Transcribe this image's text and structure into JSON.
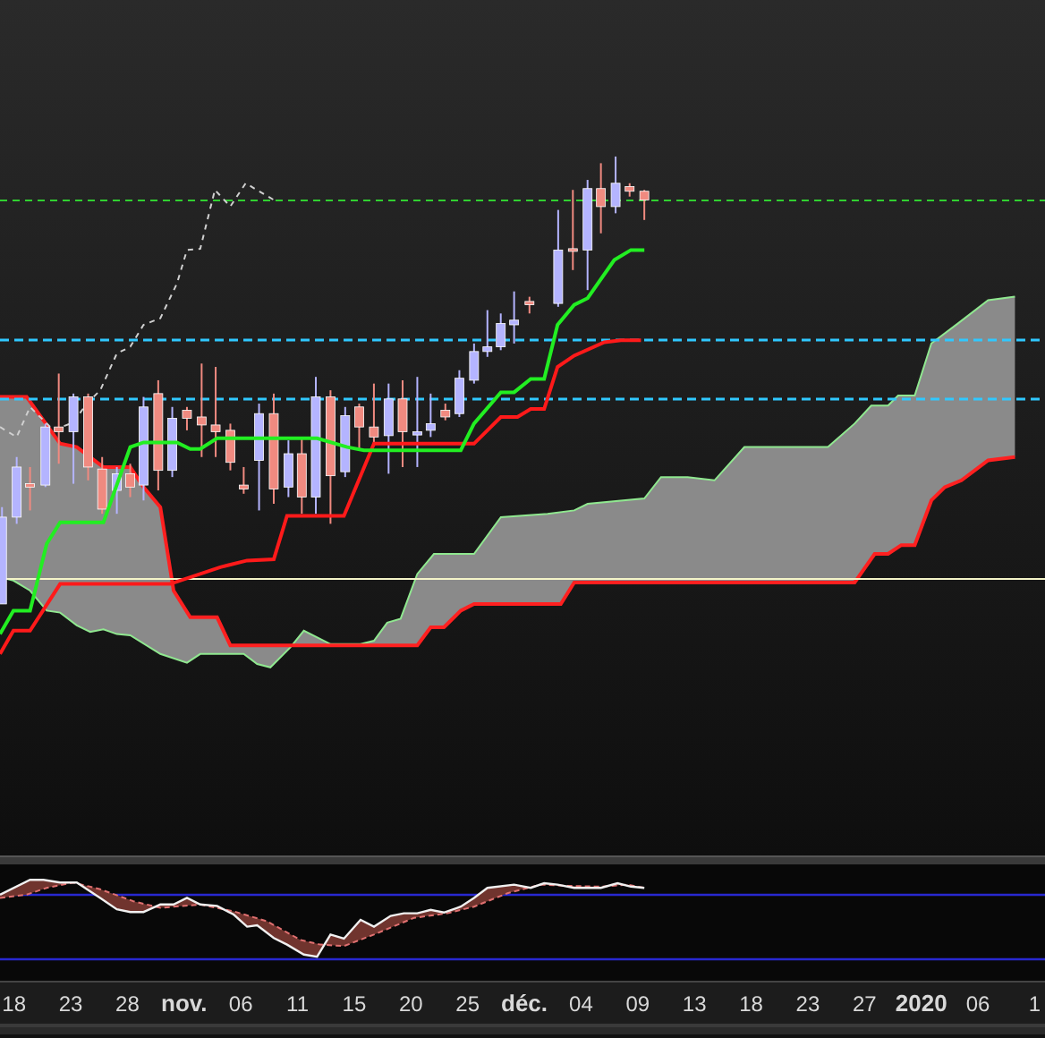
{
  "x_axis": {
    "labels": [
      {
        "text": "18",
        "bold": false
      },
      {
        "text": "23",
        "bold": false
      },
      {
        "text": "28",
        "bold": false
      },
      {
        "text": "nov.",
        "bold": true
      },
      {
        "text": "06",
        "bold": false
      },
      {
        "text": "11",
        "bold": false
      },
      {
        "text": "15",
        "bold": false
      },
      {
        "text": "20",
        "bold": false
      },
      {
        "text": "25",
        "bold": false
      },
      {
        "text": "déc.",
        "bold": true
      },
      {
        "text": "04",
        "bold": false
      },
      {
        "text": "09",
        "bold": false
      },
      {
        "text": "13",
        "bold": false
      },
      {
        "text": "18",
        "bold": false
      },
      {
        "text": "23",
        "bold": false
      },
      {
        "text": "27",
        "bold": false
      },
      {
        "text": "2020",
        "bold": true
      },
      {
        "text": "06",
        "bold": false
      },
      {
        "text": "1",
        "bold": false
      }
    ]
  }
}
